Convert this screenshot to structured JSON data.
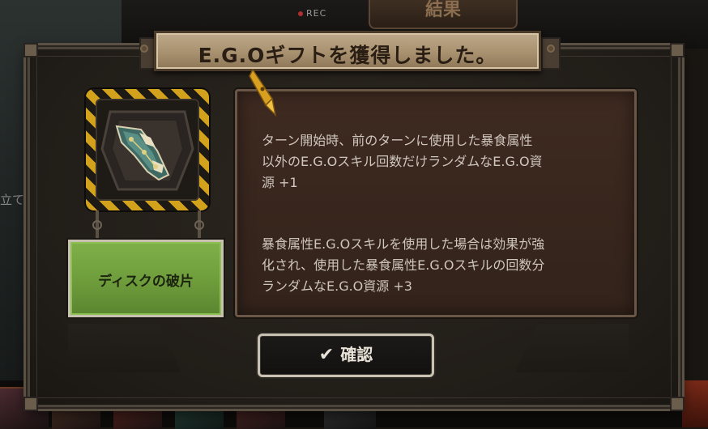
{
  "background": {
    "rec_label": "REC",
    "result_tab_label": "結果",
    "left_partial_text": "立て"
  },
  "dialog": {
    "title": "E.G.Oギフトを獲得しました。",
    "gift_name": "ディスクの破片",
    "description_p1": "ターン開始時、前のターンに使用した暴食属性\n以外のE.G.Oスキル回数だけランダムなE.G.O資\n源 +1",
    "description_p2": "暴食属性E.G.Oスキルを使用した場合は効果が強\n化され、使用した暴食属性E.G.Oスキルの回数分\nランダムなE.G.O資源 +3",
    "confirm_label": "確認",
    "confirm_icon": "check-icon",
    "gift_icon": "disk-shard-icon"
  },
  "colors": {
    "accent_gold": "#d2a21c",
    "gift_name_green": "#6c9a3a",
    "title_plate": "#a8916f",
    "desc_bg": "#3e2a20"
  }
}
